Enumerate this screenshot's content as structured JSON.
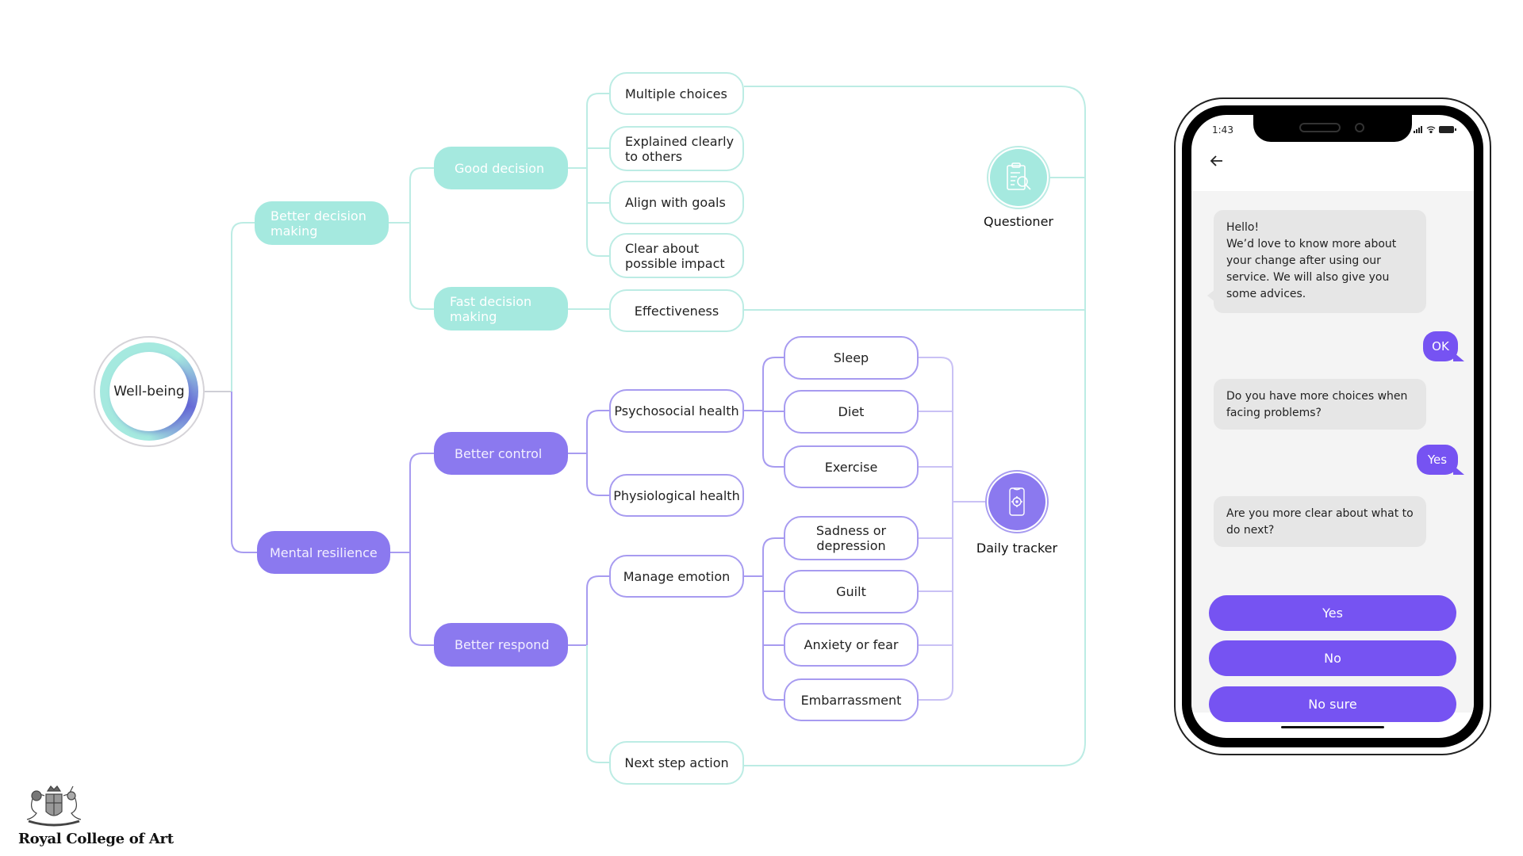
{
  "diagram": {
    "root": "Well-being",
    "branches": {
      "decision": {
        "label": "Better decision making",
        "children": {
          "good": {
            "label": "Good decision",
            "leaves": [
              "Multiple choices",
              "Explained clearly to others",
              "Align with goals",
              "Clear about possible impact"
            ]
          },
          "fast": {
            "label": "Fast decision making",
            "leaves": [
              "Effectiveness"
            ]
          }
        }
      },
      "resilience": {
        "label": "Mental resilience",
        "children": {
          "control": {
            "label": "Better control",
            "subs": {
              "psychosocial": "Psychosocial health",
              "physiological": "Physiological health"
            },
            "leaves": [
              "Sleep",
              "Diet",
              "Exercise"
            ]
          },
          "respond": {
            "label": "Better respond",
            "subs": {
              "emotion": "Manage emotion",
              "next": "Next step action"
            },
            "leaves": [
              "Sadness or depression",
              "Guilt",
              "Anxiety or fear",
              "Embarrassment"
            ]
          }
        }
      }
    },
    "tools": {
      "questioner": {
        "label": "Questioner",
        "icon": "clipboard-search-icon"
      },
      "tracker": {
        "label": "Daily tracker",
        "icon": "phone-target-icon"
      }
    },
    "colors": {
      "teal": "#a5e9df",
      "teal_line": "#bcece4",
      "purple": "#8b79ef",
      "purple_line": "#a79bf0"
    }
  },
  "phone": {
    "time": "1:43",
    "messages": [
      {
        "from": "bot",
        "text": "Hello!\nWe’d love to know more about your change after using our service. We will also give you some advices."
      },
      {
        "from": "user",
        "text": "OK"
      },
      {
        "from": "bot",
        "text": "Do you have more choices when facing problems?"
      },
      {
        "from": "user",
        "text": "Yes"
      },
      {
        "from": "bot",
        "text": "Are you more clear about what to do next?"
      }
    ],
    "choices": [
      "Yes",
      "No",
      "No sure"
    ],
    "accent": "#7653f2"
  },
  "logo": {
    "text": "Royal College of Art"
  }
}
